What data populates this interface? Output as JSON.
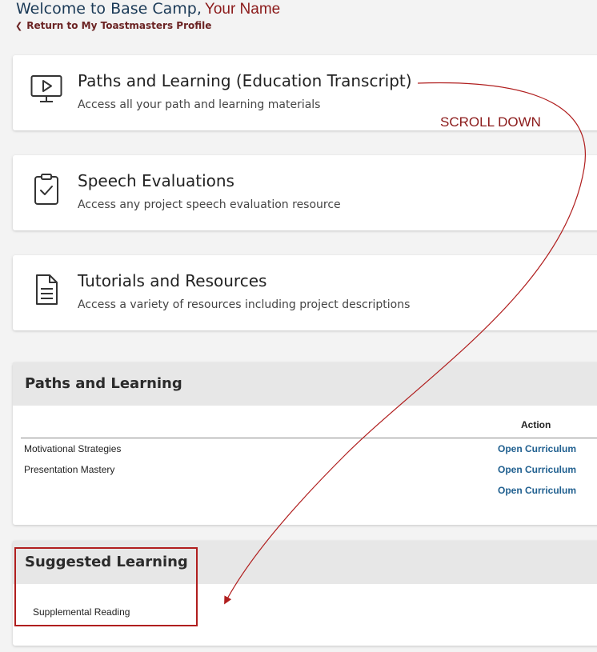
{
  "header": {
    "welcome": "Welcome to Base Camp,",
    "user_name": "Your Name",
    "back_link": "Return to My Toastmasters Profile"
  },
  "cards": [
    {
      "title": "Paths and Learning (Education Transcript)",
      "description": "Access all your path and learning materials",
      "icon": "monitor-play-icon"
    },
    {
      "title": "Speech Evaluations",
      "description": "Access any project speech evaluation resource",
      "icon": "clipboard-check-icon"
    },
    {
      "title": "Tutorials and Resources",
      "description": "Access a variety of resources including project descriptions",
      "icon": "document-icon"
    }
  ],
  "annotation": {
    "scroll_note": "SCROLL DOWN",
    "color": "#8b1a1a"
  },
  "paths_panel": {
    "heading": "Paths and Learning",
    "action_header": "Action",
    "rows": [
      {
        "name": "Motivational Strategies",
        "action": "Open Curriculum"
      },
      {
        "name": "Presentation Mastery",
        "action": "Open Curriculum"
      },
      {
        "name": "",
        "action": "Open Curriculum"
      }
    ]
  },
  "suggested_panel": {
    "heading": "Suggested Learning",
    "items": [
      "Supplemental Reading"
    ]
  }
}
